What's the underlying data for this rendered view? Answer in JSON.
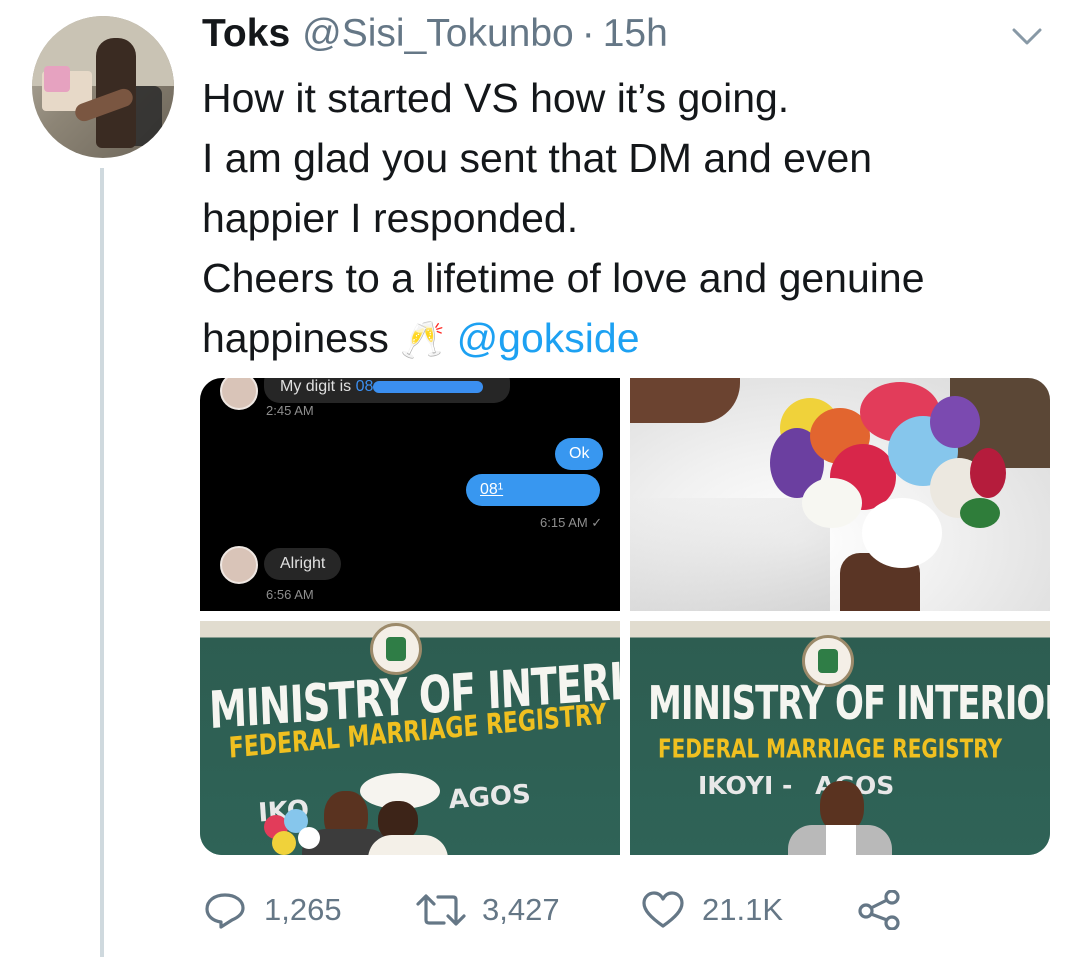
{
  "tweet": {
    "author_name": "Toks",
    "handle": "@Sisi_Tokunbo",
    "separator": "·",
    "time": "15h",
    "lines": [
      "How it started VS how it’s going.",
      "I am glad you sent that DM and even",
      "happier I responded.",
      "Cheers to a lifetime of love and genuine"
    ],
    "last_line_text": "happiness ",
    "emoji": "🥂",
    "mention": "@gokside"
  },
  "media": {
    "chat": {
      "msg1_prefix": "My digit is ",
      "msg1_visible": "08",
      "ts1": "2:45 AM",
      "reply1": "Ok",
      "reply2_visible": "08¹",
      "ts2": "6:15 AM ✓",
      "msg2": "Alright",
      "ts3": "6:56 AM"
    },
    "sign_left": {
      "line1": "MINISTRY  OF  INTERIOR",
      "line2": "FEDERAL MARRIAGE REGISTRY",
      "line3_a": "IKO",
      "line3_b": "AGOS"
    },
    "sign_right": {
      "line1": "MINISTRY  OF  INTERIOR",
      "line2": "FEDERAL MARRIAGE REGISTRY",
      "line3_a": "IKOYI - ",
      "line3_b": "AGOS"
    }
  },
  "actions": {
    "replies": "1,265",
    "retweets": "3,427",
    "likes": "21.1K"
  },
  "colors": {
    "link": "#1da1f2",
    "muted": "#657786",
    "thread_line": "#cfd9de"
  },
  "icons": [
    "chevron-down-icon",
    "reply-icon",
    "retweet-icon",
    "like-icon",
    "share-icon"
  ]
}
